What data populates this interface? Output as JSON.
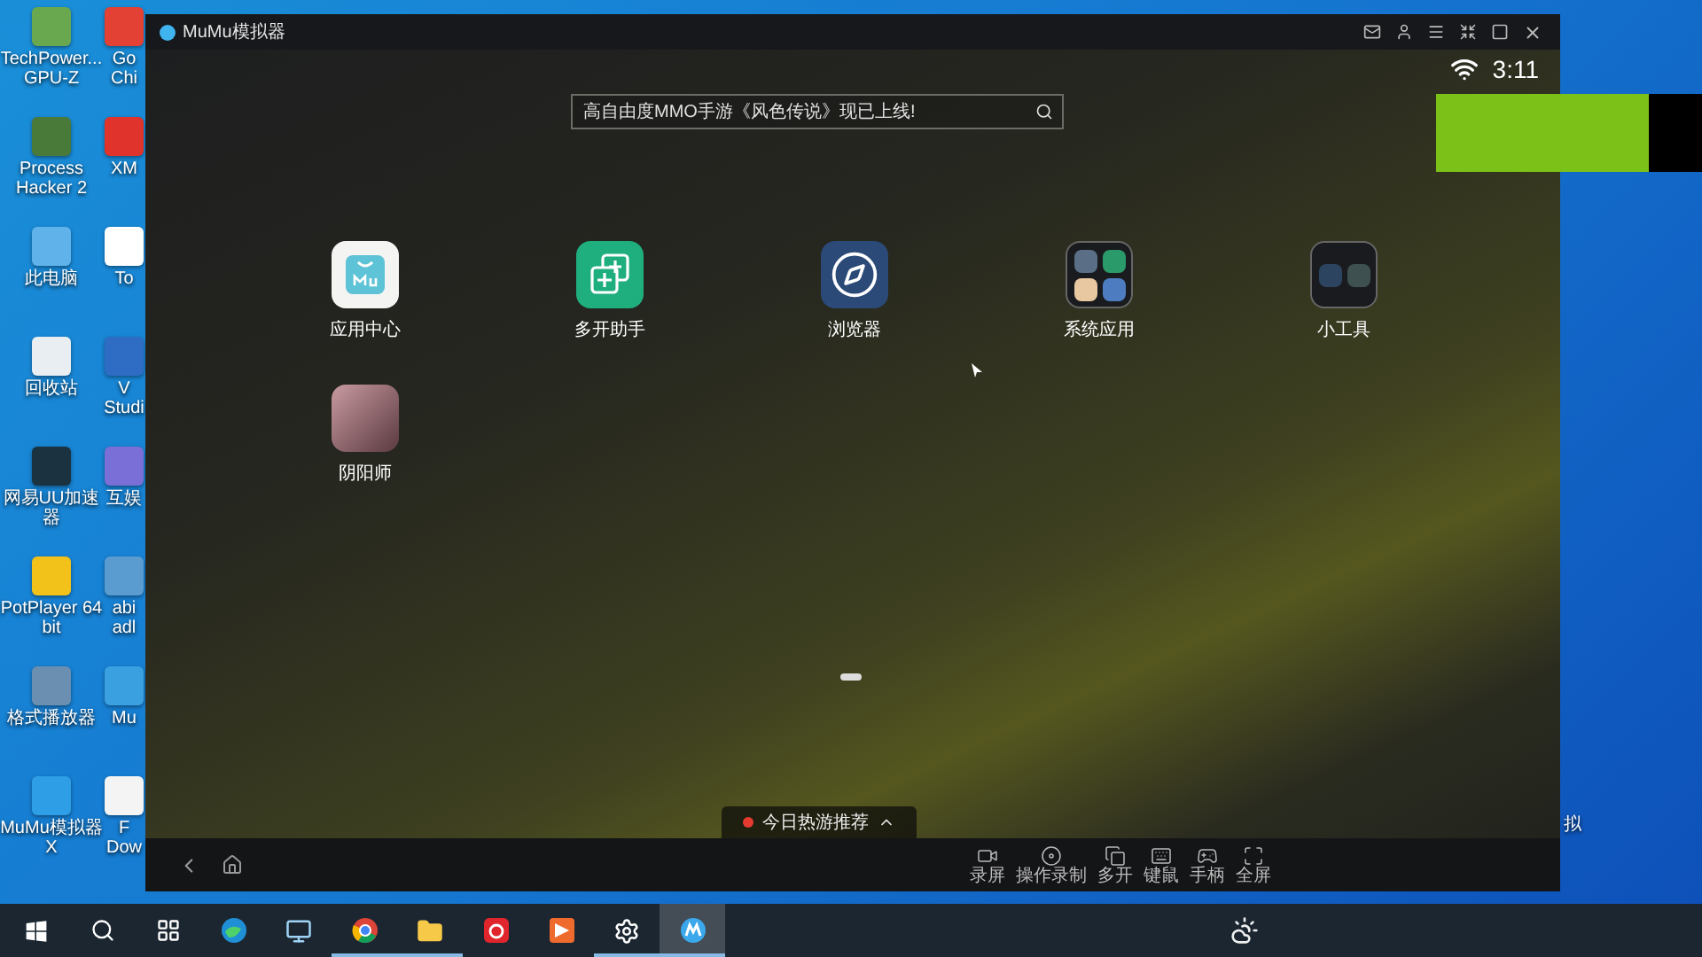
{
  "desktop": {
    "column_1": [
      {
        "label": "TechPower... GPU-Z",
        "color": "#6aa84f"
      },
      {
        "label": "Process Hacker 2",
        "color": "#4a7a3a"
      },
      {
        "label": "此电脑",
        "color": "#5fb3ea"
      },
      {
        "label": "回收站",
        "color": "#e8eef2"
      },
      {
        "label": "网易UU加速器",
        "color": "#1b3340"
      },
      {
        "label": "PotPlayer 64 bit",
        "color": "#f2c21b"
      },
      {
        "label": "格式播放器",
        "color": "#6a8fb0"
      },
      {
        "label": "MuMu模拟器X",
        "color": "#2e9fe6"
      }
    ],
    "column_2": [
      {
        "label": "Go Chi",
        "color": "#e34133"
      },
      {
        "label": "XM",
        "color": "#e0332b"
      },
      {
        "label": "To",
        "color": "#ffffff"
      },
      {
        "label": "V Studi",
        "color": "#2f6cc4"
      },
      {
        "label": "互娱",
        "color": "#7a6fd6"
      },
      {
        "label": "abi adl",
        "color": "#5a9bd0"
      },
      {
        "label": "Mu",
        "color": "#3aa0e0"
      },
      {
        "label": "F Dow",
        "color": "#f4f4f4"
      }
    ],
    "right_label": "拟"
  },
  "window": {
    "title": "MuMu模拟器"
  },
  "status_bar": {
    "time": "3:11"
  },
  "search": {
    "placeholder": "高自由度MMO手游《风色传说》现已上线!"
  },
  "apps": [
    {
      "label": "应用中心",
      "kind": "store"
    },
    {
      "label": "多开助手",
      "kind": "multi"
    },
    {
      "label": "浏览器",
      "kind": "browser"
    },
    {
      "label": "系统应用",
      "kind": "folder"
    },
    {
      "label": "小工具",
      "kind": "tools"
    },
    {
      "label": "阴阳师",
      "kind": "game"
    }
  ],
  "hot_games": {
    "label": "今日热游推荐"
  },
  "toolbar": [
    {
      "label": "录屏",
      "kind": "record"
    },
    {
      "label": "操作录制",
      "kind": "macro"
    },
    {
      "label": "多开",
      "kind": "multi"
    },
    {
      "label": "键鼠",
      "kind": "keyboard"
    },
    {
      "label": "手柄",
      "kind": "gamepad"
    },
    {
      "label": "全屏",
      "kind": "fullscreen"
    }
  ],
  "taskbar": [
    {
      "kind": "start",
      "running": false,
      "selected": false
    },
    {
      "kind": "search",
      "running": false,
      "selected": false
    },
    {
      "kind": "taskview",
      "running": false,
      "selected": false
    },
    {
      "kind": "edge",
      "running": false,
      "selected": false
    },
    {
      "kind": "computer",
      "running": false,
      "selected": false
    },
    {
      "kind": "chrome",
      "running": true,
      "selected": false
    },
    {
      "kind": "explorer",
      "running": true,
      "selected": false
    },
    {
      "kind": "music",
      "running": false,
      "selected": false
    },
    {
      "kind": "player",
      "running": false,
      "selected": false
    },
    {
      "kind": "settings",
      "running": true,
      "selected": false
    },
    {
      "kind": "mumu",
      "running": true,
      "selected": true
    }
  ]
}
